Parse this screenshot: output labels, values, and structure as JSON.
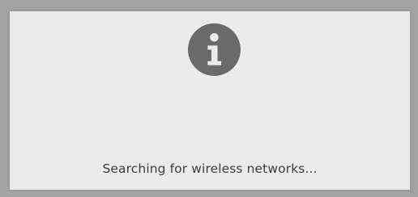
{
  "dialog": {
    "icon": "info-icon",
    "message": "Searching for wireless networks..."
  },
  "colors": {
    "background": "#a2a2a2",
    "panel": "#ebebeb",
    "icon_fill": "#6a6a6a",
    "icon_glyph": "#ebebeb",
    "text": "#3c3c3c"
  }
}
